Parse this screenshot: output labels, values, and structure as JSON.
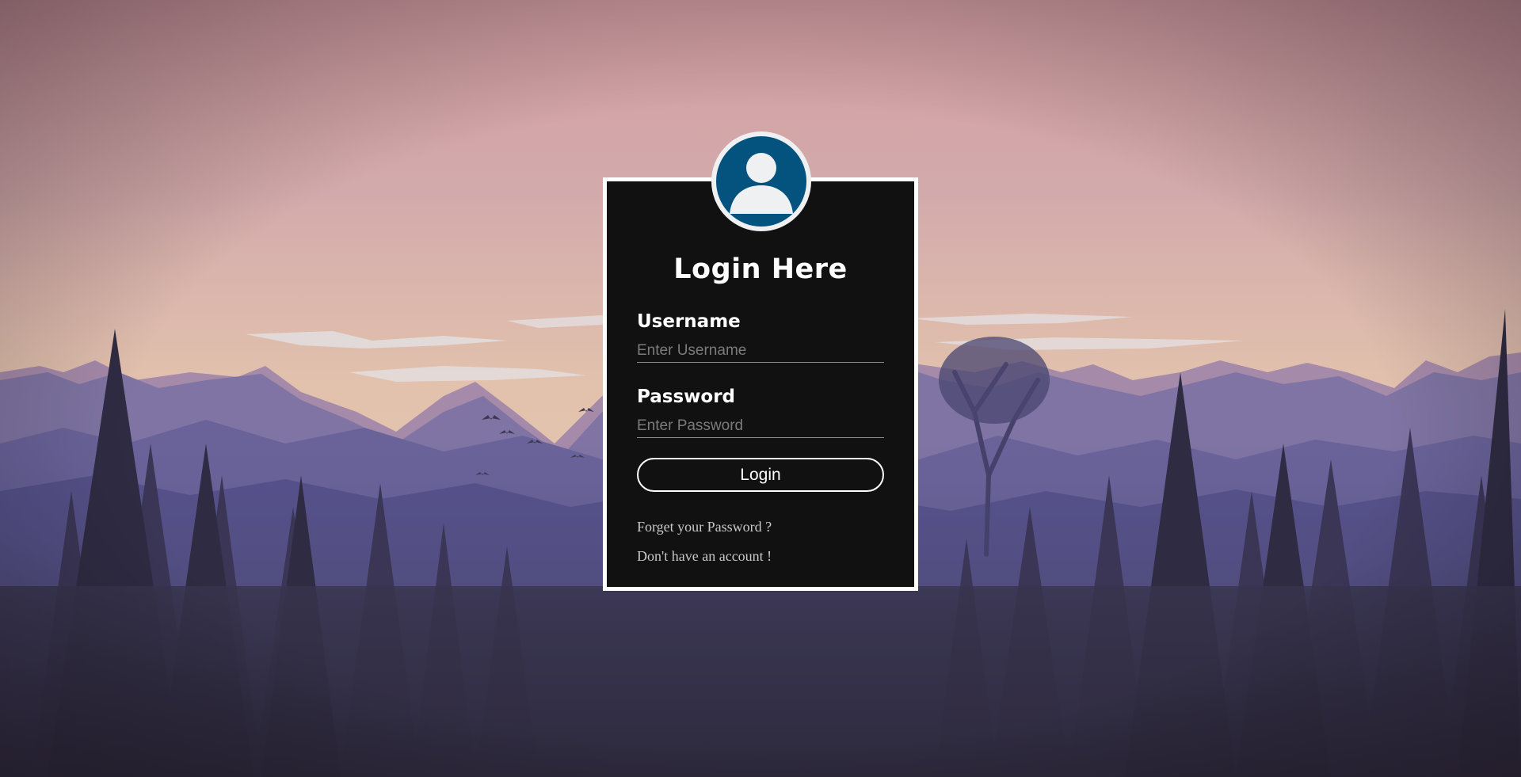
{
  "login": {
    "title": "Login Here",
    "username_label": "Username",
    "username_placeholder": "Enter Username",
    "password_label": "Password",
    "password_placeholder": "Enter Password",
    "login_button": "Login",
    "forgot_link": "Forget your Password ?",
    "signup_link": "Don't have an account !"
  },
  "icons": {
    "avatar": "user-avatar-icon"
  },
  "colors": {
    "card_background": "#111111",
    "card_border": "#ffffff",
    "avatar_background": "#04537e",
    "sky_top": "#d39ea3",
    "sky_horizon": "#e2c2ad",
    "forest_dark": "#2d2a3e"
  }
}
